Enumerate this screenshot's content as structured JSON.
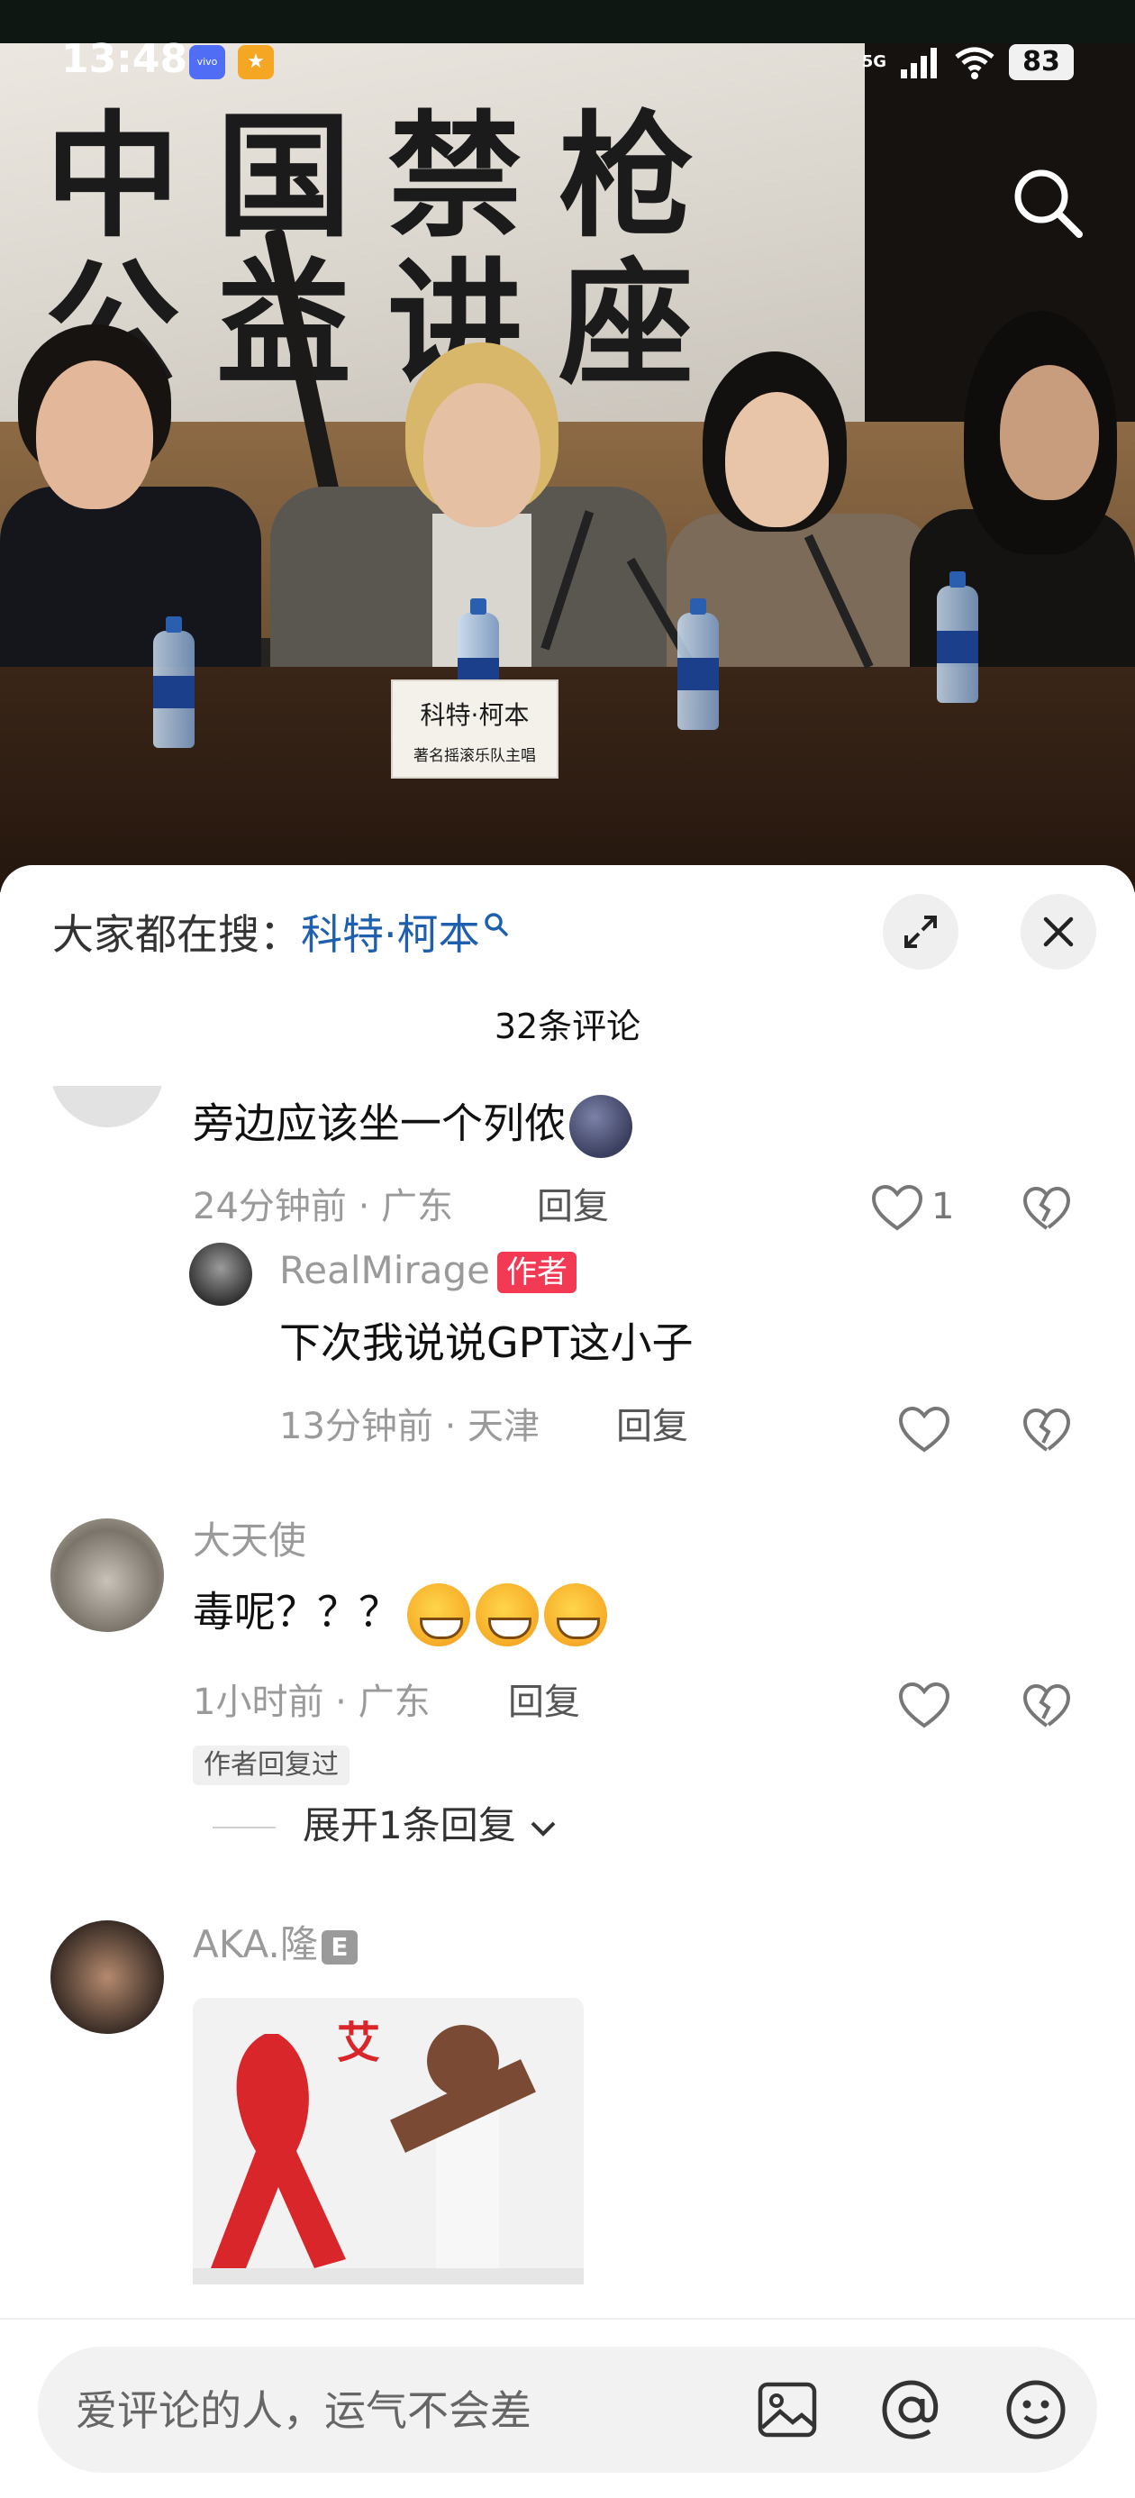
{
  "status_bar": {
    "time": "13:48",
    "app_badge_1": "vivo",
    "app_badge_2": "★",
    "network": "5G",
    "battery": "83"
  },
  "photo": {
    "banner_line_1": "中国禁枪",
    "banner_line_2": "公益讲座",
    "nameplate_name": "科特·柯本",
    "nameplate_sub": "著名摇滚乐队主唱"
  },
  "sheet": {
    "hot_search_prefix": "大家都在搜：",
    "hot_search_keyword": "科特·柯本",
    "comment_count": "32条评论"
  },
  "comments": [
    {
      "text": "旁边应该坐一个列侬",
      "time": "24分钟前 · 广东",
      "reply_label": "回复",
      "likes": "1",
      "replies": [
        {
          "user": "RealMirage",
          "tag": "作者",
          "text": "下次我说说GPT这小子",
          "time": "13分钟前 · 天津",
          "reply_label": "回复"
        }
      ]
    },
    {
      "user": "大天使",
      "text": "毒呢？？？",
      "time": "1小时前 · 广东",
      "reply_label": "回复",
      "author_replied": "作者回复过",
      "expand_replies": "展开1条回复"
    },
    {
      "user": "AKA.隆",
      "user_badge": "E",
      "image_text": "艾"
    }
  ],
  "input": {
    "placeholder": "爱评论的人，运气不会差"
  },
  "colors": {
    "link_blue": "#1f5fb0",
    "author_tag": "#f23a55",
    "muted_text": "#9a9a9a"
  },
  "icons": [
    "search-icon",
    "expand-icon",
    "close-icon",
    "heart-icon",
    "broken-heart-icon",
    "image-icon",
    "at-icon",
    "emoji-icon",
    "chevron-down-icon"
  ]
}
